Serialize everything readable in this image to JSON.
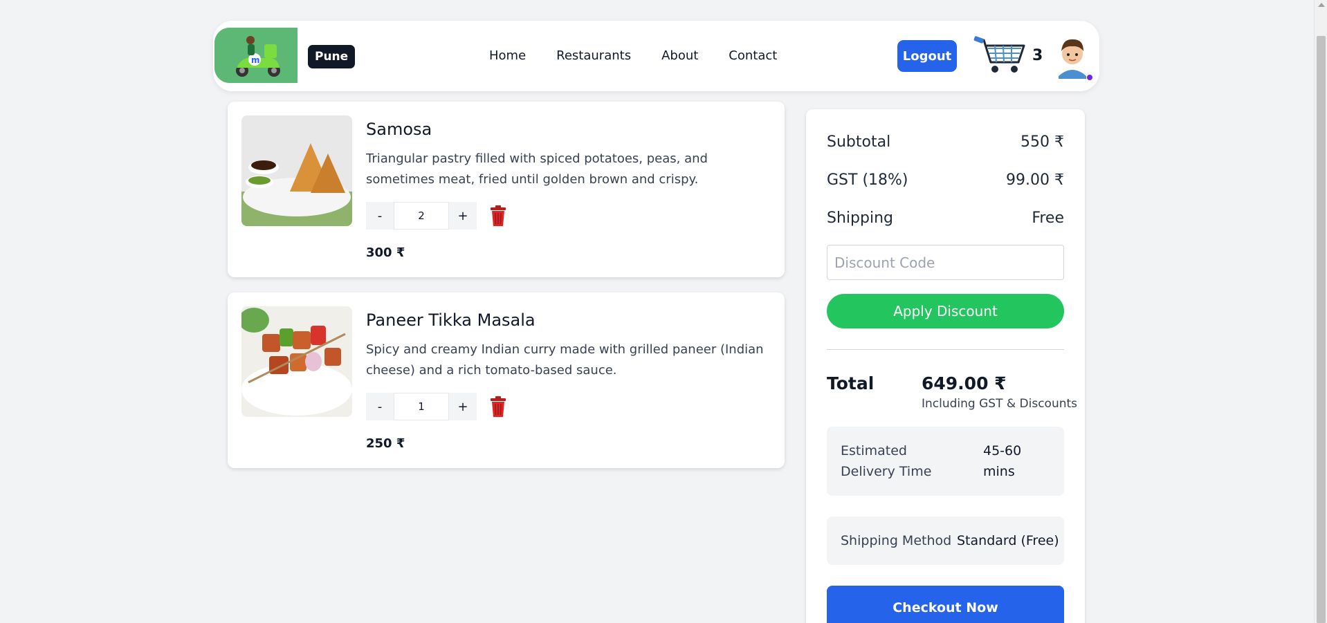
{
  "header": {
    "city": "Pune",
    "nav": [
      "Home",
      "Restaurants",
      "About",
      "Contact"
    ],
    "logout_label": "Logout",
    "cart_count": "3"
  },
  "items": [
    {
      "name": "Samosa",
      "description": "Triangular pastry filled with spiced potatoes, peas, and sometimes meat, fried until golden brown and crispy.",
      "quantity": "2",
      "price": "300 ₹",
      "minus": "-",
      "plus": "+"
    },
    {
      "name": "Paneer Tikka Masala",
      "description": "Spicy and creamy Indian curry made with grilled paneer (Indian cheese) and a rich tomato-based sauce.",
      "quantity": "1",
      "price": "250 ₹",
      "minus": "-",
      "plus": "+"
    }
  ],
  "summary": {
    "subtotal_label": "Subtotal",
    "subtotal_value": "550 ₹",
    "gst_label": "GST (18%)",
    "gst_value": "99.00 ₹",
    "shipping_label": "Shipping",
    "shipping_value": "Free",
    "discount_placeholder": "Discount Code",
    "apply_label": "Apply Discount",
    "total_label": "Total",
    "total_value": "649.00 ₹",
    "total_note": "Including GST & Discounts",
    "delivery_label": "Estimated Delivery Time",
    "delivery_value": "45-60 mins",
    "method_label": "Shipping Method",
    "method_value": "Standard (Free)",
    "checkout_label": "Checkout Now"
  },
  "colors": {
    "primary": "#2563eb",
    "success": "#22c55e",
    "dark": "#111827",
    "logo_bg": "#5cb874"
  },
  "icons": [
    "delivery-scooter-logo",
    "shopping-cart-icon",
    "user-avatar",
    "trash-icon"
  ]
}
